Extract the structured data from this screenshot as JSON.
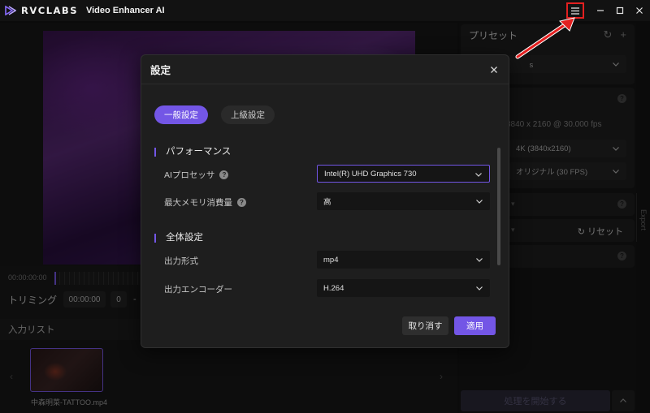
{
  "titlebar": {
    "brand": "RVCLABS",
    "app_title": "Video Enhancer AI"
  },
  "left": {
    "time_start": "00:00:00:00",
    "trim_label": "トリミング",
    "trim_time": "00:00:00",
    "trim_frame": "0",
    "trim_dash": "-",
    "input_list_title": "入力リスト",
    "file_name": "中森明菜-TATTOO.mp4"
  },
  "right": {
    "preset_title": "プリセット",
    "preset_select_visible": "　　　　　　　s",
    "resolution_info": "3840 x 2160 @ 30.000 fps",
    "res_select": "4K (3840x2160)",
    "fps_select": "オリジナル (30 FPS)",
    "reset_label": "リセット",
    "export_label": "Export",
    "start_label": "処理を開始する"
  },
  "modal": {
    "title": "設定",
    "tabs": [
      "一般設定",
      "上級設定"
    ],
    "perf_title": "パフォーマンス",
    "ai_processor_label": "AIプロセッサ",
    "ai_processor_value": "Intel(R) UHD Graphics 730",
    "max_memory_label": "最大メモリ消費量",
    "max_memory_value": "高",
    "global_title": "全体設定",
    "output_format_label": "出力形式",
    "output_format_value": "mp4",
    "encoder_label": "出力エンコーダー",
    "encoder_value": "H.264",
    "cancel_label": "取り消す",
    "apply_label": "適用"
  },
  "colors": {
    "accent": "#7356e6",
    "annotation_red": "#e32020",
    "background": "#141414"
  }
}
